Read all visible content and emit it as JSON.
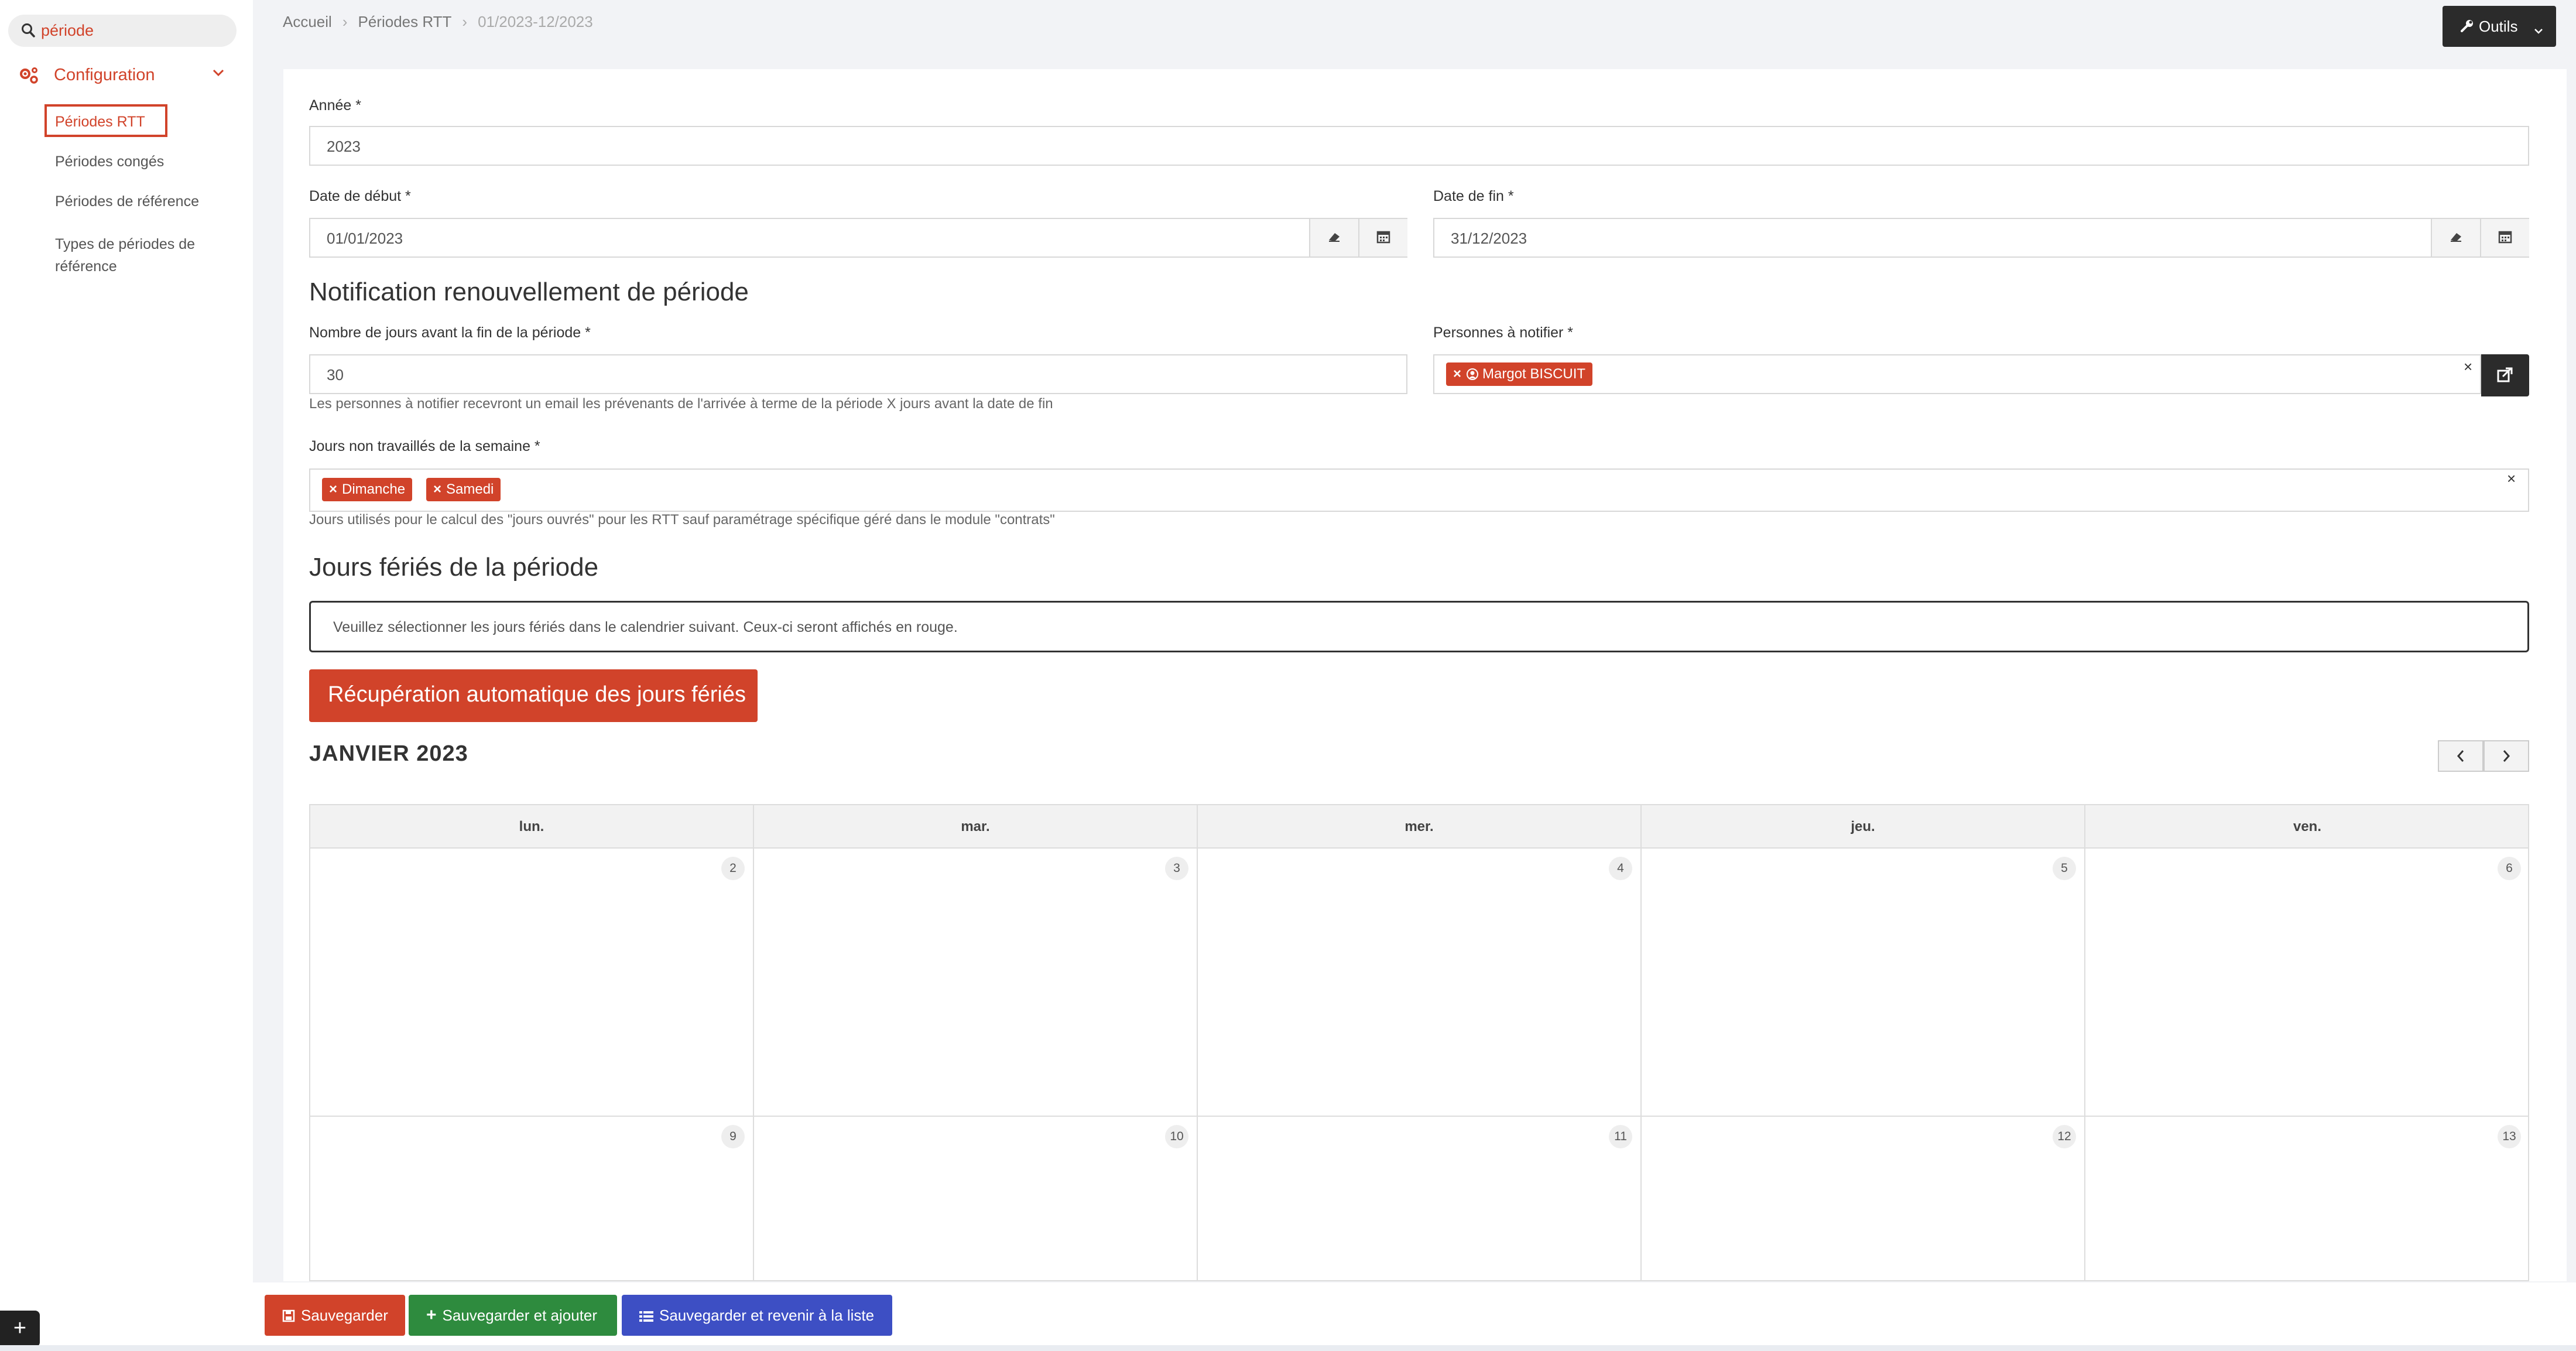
{
  "sidebar": {
    "search": {
      "value": "période"
    },
    "config": {
      "label": "Configuration"
    },
    "items": [
      {
        "label": "Périodes RTT",
        "active": true
      },
      {
        "label": "Périodes congés"
      },
      {
        "label": "Périodes de référence"
      },
      {
        "label": "Types de périodes de référence"
      }
    ],
    "float_add": "+"
  },
  "header": {
    "breadcrumb": [
      "Accueil",
      "Périodes RTT",
      "01/2023-12/2023"
    ],
    "tools_label": "Outils"
  },
  "form": {
    "annee": {
      "label": "Année *",
      "value": "2023"
    },
    "date_debut": {
      "label": "Date de début *",
      "value": "01/01/2023"
    },
    "date_fin": {
      "label": "Date de fin *",
      "value": "31/12/2023"
    },
    "notif_title": "Notification renouvellement de période",
    "nb_jours": {
      "label": "Nombre de jours avant la fin de la période *",
      "value": "30",
      "help": "Les personnes à notifier recevront un email les prévenants de l'arrivée à terme de la période X jours avant la date de fin"
    },
    "personnes": {
      "label": "Personnes à notifier *",
      "tags": [
        "Margot BISCUIT"
      ]
    },
    "jours_non": {
      "label": "Jours non travaillés de la semaine *",
      "tags": [
        "Dimanche",
        "Samedi"
      ],
      "help": "Jours utilisés pour le calcul des \"jours ouvrés\" pour les RTT sauf paramétrage spécifique géré dans le module \"contrats\""
    },
    "feries_title": "Jours fériés de la période",
    "notice": "Veuillez sélectionner les jours fériés dans le calendrier suivant. Ceux-ci seront affichés en rouge.",
    "auto_button": "Récupération automatique des jours fériés"
  },
  "calendar": {
    "month": "JANVIER 2023",
    "days": [
      "lun.",
      "mar.",
      "mer.",
      "jeu.",
      "ven."
    ],
    "weeks": [
      [
        "2",
        "3",
        "4",
        "5",
        "6"
      ],
      [
        "9",
        "10",
        "11",
        "12",
        "13"
      ]
    ]
  },
  "footer": {
    "save": "Sauvegarder",
    "save_add": "Sauvegarder et ajouter",
    "save_back": "Sauvegarder et revenir à la liste"
  },
  "colors": {
    "accent": "#d1432a",
    "dark": "#2b2b2b",
    "green": "#2e8b3e",
    "blue": "#3d4fc4"
  }
}
